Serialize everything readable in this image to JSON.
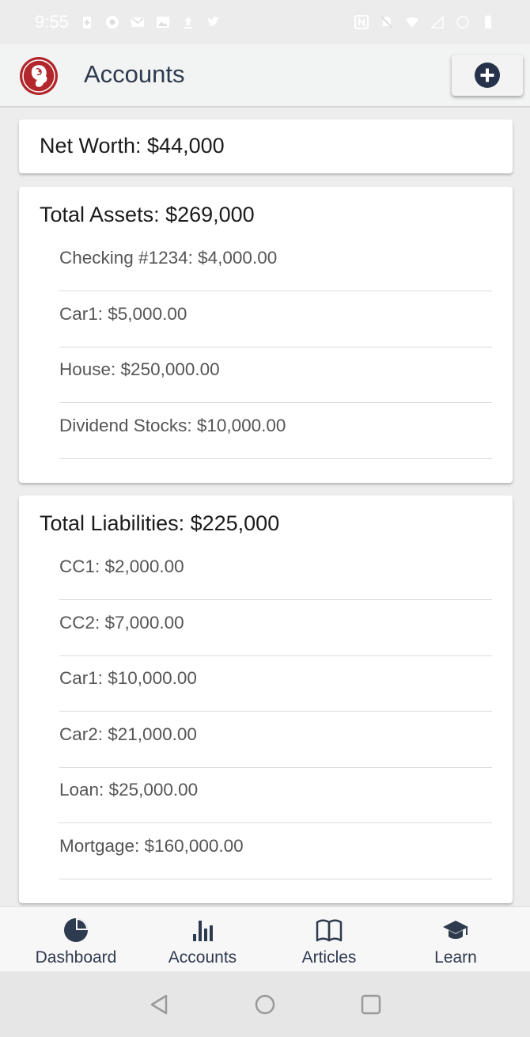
{
  "status_bar": {
    "time": "9:55"
  },
  "app_bar": {
    "title": "Accounts"
  },
  "net_worth": {
    "label": "Net Worth: $44,000"
  },
  "assets": {
    "title": "Total Assets: $269,000",
    "items": [
      "Checking #1234: $4,000.00",
      "Car1: $5,000.00",
      "House: $250,000.00",
      "Dividend Stocks: $10,000.00"
    ]
  },
  "liabilities": {
    "title": "Total Liabilities: $225,000",
    "items": [
      "CC1: $2,000.00",
      "CC2: $7,000.00",
      "Car1: $10,000.00",
      "Car2: $21,000.00",
      "Loan: $25,000.00",
      "Mortgage: $160,000.00"
    ]
  },
  "bottom_nav": [
    {
      "label": "Dashboard",
      "icon": "pie-chart-icon"
    },
    {
      "label": "Accounts",
      "icon": "bar-chart-icon"
    },
    {
      "label": "Articles",
      "icon": "open-book-icon"
    },
    {
      "label": "Learn",
      "icon": "graduation-cap-icon"
    }
  ],
  "colors": {
    "primary": "#2e3a4e",
    "logo_red": "#b3262b",
    "background": "#ededed"
  }
}
